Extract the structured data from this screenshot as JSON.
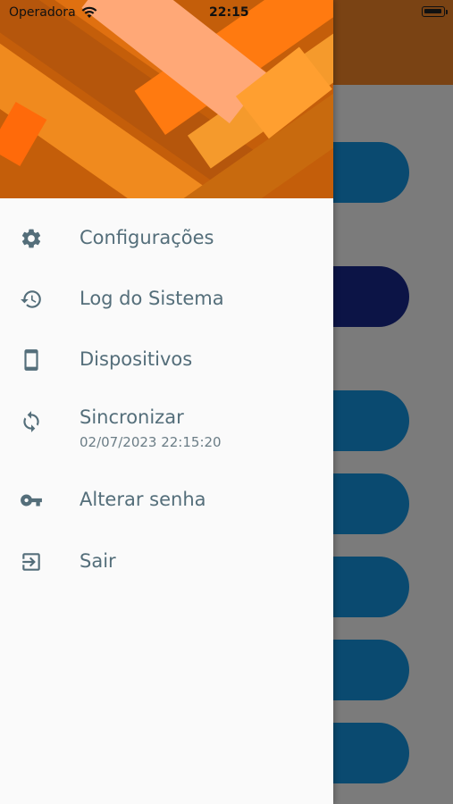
{
  "status_bar": {
    "carrier": "Operadora",
    "time": "22:15"
  },
  "drawer": {
    "items": [
      {
        "label": "Configurações",
        "icon": "gear-icon"
      },
      {
        "label": "Log do Sistema",
        "icon": "history-icon"
      },
      {
        "label": "Dispositivos",
        "icon": "smartphone-icon"
      },
      {
        "label": "Sincronizar",
        "icon": "sync-icon",
        "subtitle": "02/07/2023 22:15:20"
      },
      {
        "label": "Alterar senha",
        "icon": "key-icon"
      },
      {
        "label": "Sair",
        "icon": "logout-icon"
      }
    ]
  },
  "colors": {
    "icon": "#546e7a",
    "label": "#546e7a",
    "header_orange": "#f07f12",
    "scrim_overlay": "#7b7b7b",
    "button_blue": "#0a4a70"
  }
}
